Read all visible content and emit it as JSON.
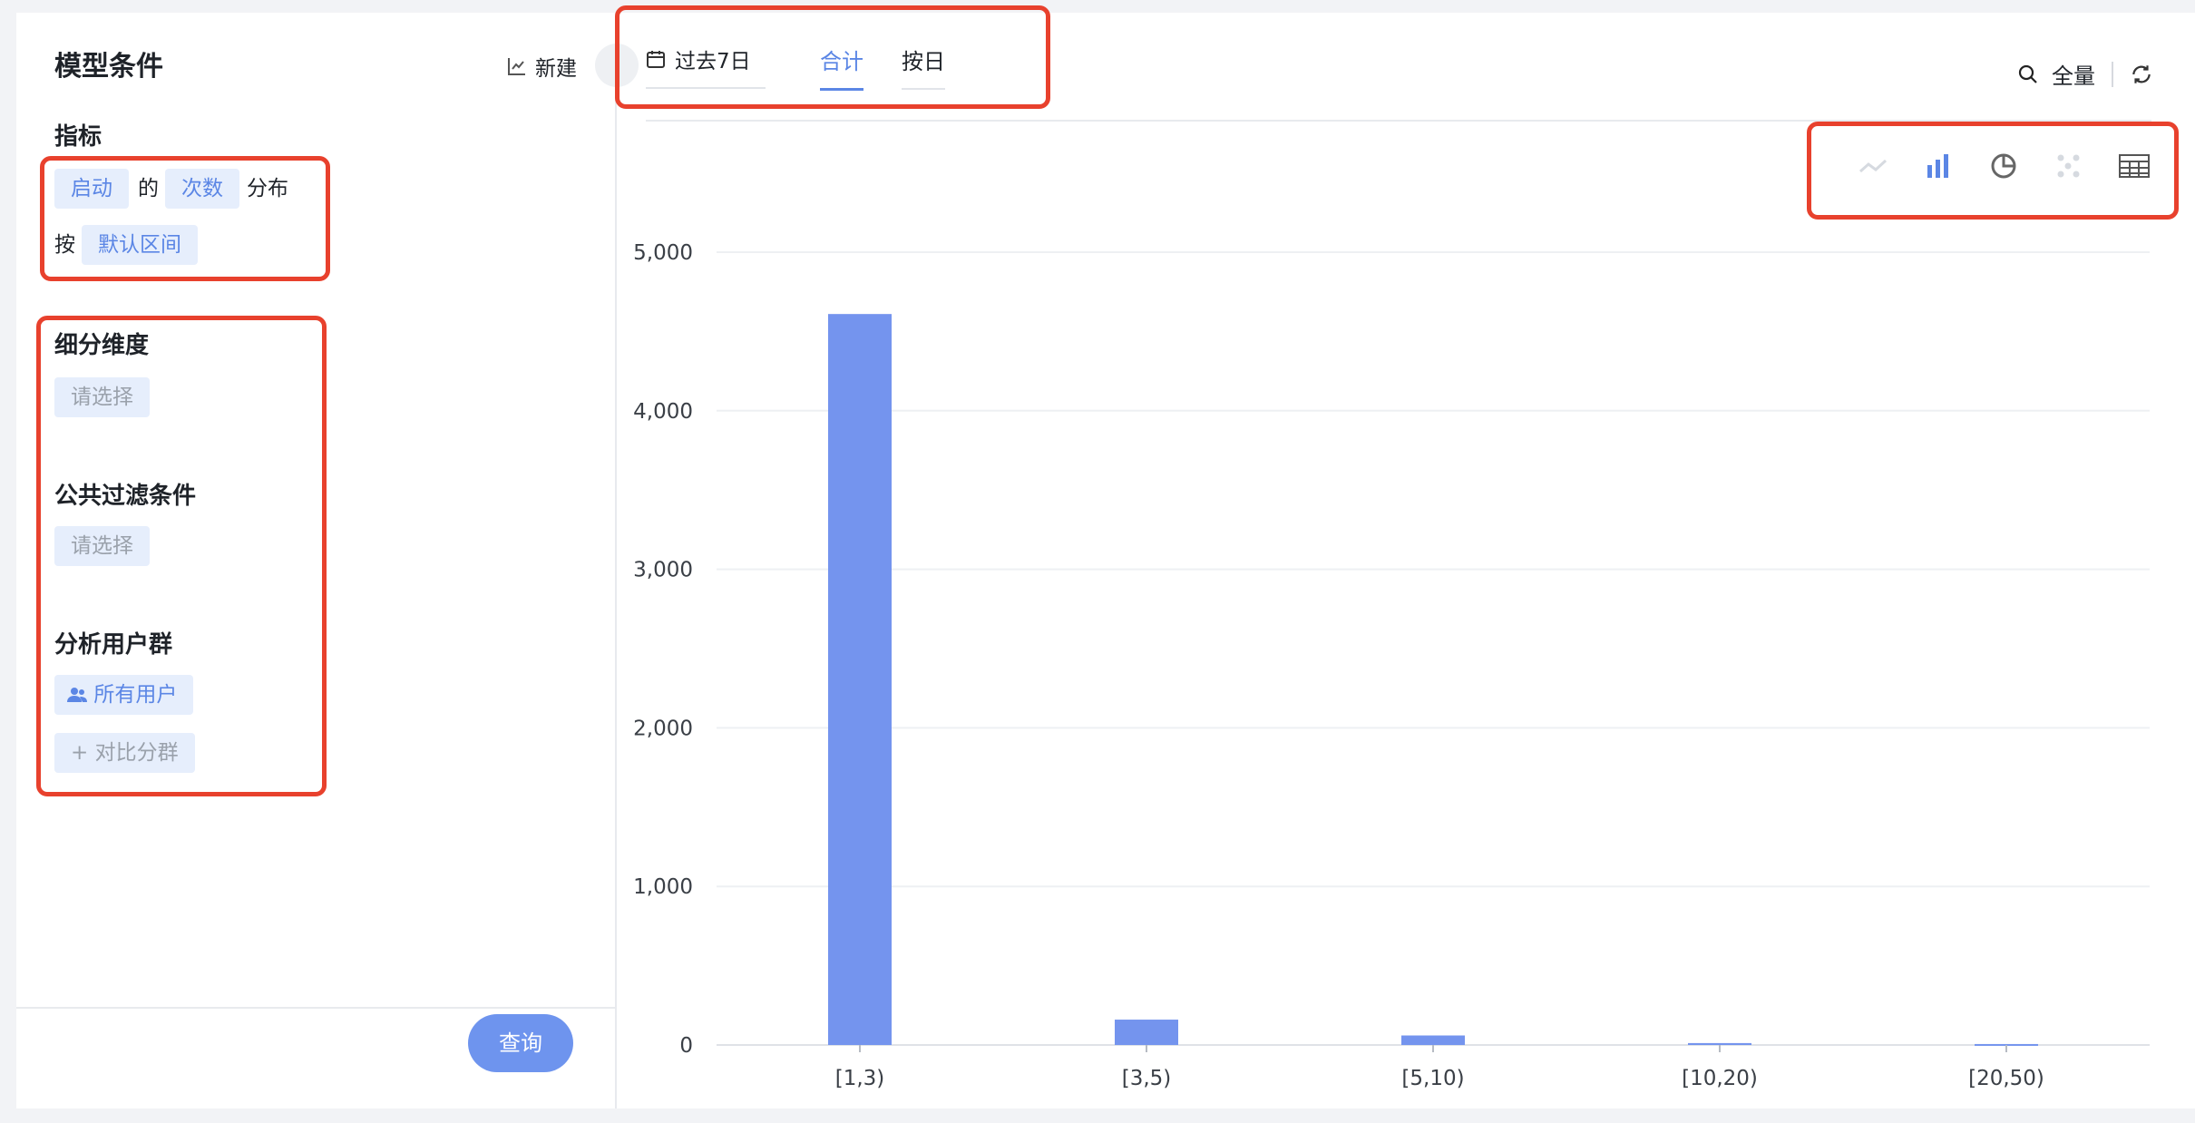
{
  "left": {
    "title": "模型条件",
    "new_label": "新建",
    "metric": {
      "title": "指标",
      "event": "启动",
      "of": "的",
      "measure": "次数",
      "dist": "分布",
      "by": "按",
      "interval": "默认区间"
    },
    "breakdown": {
      "title": "细分维度",
      "placeholder": "请选择"
    },
    "filter": {
      "title": "公共过滤条件",
      "placeholder": "请选择"
    },
    "segment": {
      "title": "分析用户群",
      "all_users": "所有用户",
      "compare": "+ 对比分群"
    },
    "query_label": "查询"
  },
  "topbar": {
    "date_range": "过去7日",
    "tabs": [
      {
        "label": "合计",
        "active": true
      },
      {
        "label": "按日",
        "active": false
      }
    ],
    "sample_label": "全量"
  },
  "chart_types": [
    "line-chart-icon",
    "bar-chart-icon",
    "pie-chart-icon",
    "scatter-chart-icon",
    "table-icon"
  ],
  "colors": {
    "accent": "#5b86e5",
    "bar": "#7494ee",
    "highlight": "#e8412d"
  },
  "chart_data": {
    "type": "bar",
    "categories": [
      "[1,3)",
      "[3,5)",
      "[5,10)",
      "[10,20)",
      "[20,50)"
    ],
    "values": [
      4610,
      160,
      60,
      12,
      6
    ],
    "ylim": [
      0,
      5000
    ],
    "yticks": [
      0,
      1000,
      2000,
      3000,
      4000,
      5000
    ],
    "ytick_labels": [
      "0",
      "1,000",
      "2,000",
      "3,000",
      "4,000",
      "5,000"
    ],
    "grid": true,
    "legend": false
  }
}
